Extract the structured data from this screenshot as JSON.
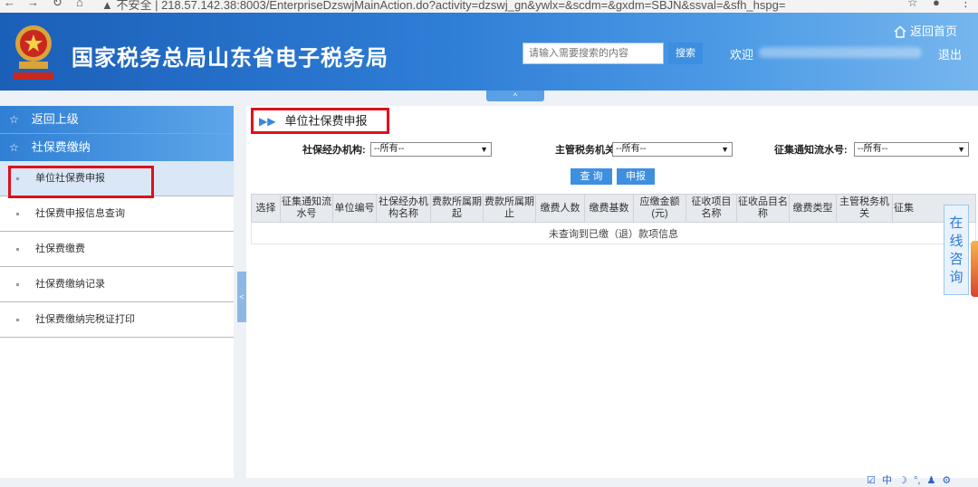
{
  "browser": {
    "url_text": "▲ 不安全 | 218.57.142.38:8003/EnterpriseDzswjMainAction.do?activity=dzswj_gn&ywlx=&scdm=&gxdm=SBJN&ssval=&sfh_hspg="
  },
  "header": {
    "site_title": "国家税务总局山东省电子税务局",
    "search_placeholder": "请输入需要搜索的内容",
    "search_button": "搜索",
    "welcome": "欢迎",
    "home_link": "返回首页",
    "logout": "退出",
    "collapse_arrow": "^"
  },
  "sidebar": {
    "back": "返回上级",
    "section": "社保费缴纳",
    "items": [
      {
        "label": "单位社保费申报"
      },
      {
        "label": "社保费申报信息查询"
      },
      {
        "label": "社保费缴费"
      },
      {
        "label": "社保费缴纳记录"
      },
      {
        "label": "社保费缴纳完税证打印"
      }
    ],
    "splitter_arrow": "<"
  },
  "main": {
    "page_title": "单位社保费申报",
    "filters": {
      "agency_label": "社保经办机构:",
      "agency_value": "--所有--",
      "tax_office_label": "主管税务机关:",
      "tax_office_value": "--所有--",
      "notice_label": "征集通知流水号:",
      "notice_value": "--所有--"
    },
    "buttons": {
      "query": "查 询",
      "declare": "申报"
    },
    "table": {
      "headers": [
        "选择",
        "征集通知流水号",
        "单位编号",
        "社保经办机构名称",
        "费款所属期起",
        "费款所属期止",
        "缴费人数",
        "缴费基数",
        "应缴金额(元)",
        "征收项目名称",
        "征收品目名称",
        "缴费类型",
        "主管税务机关",
        "征集"
      ],
      "empty_message": "未查询到已缴（退）款项信息"
    }
  },
  "consult_widget": {
    "text": "在线咨询"
  },
  "ime_bar": {
    "items": [
      "☑",
      "中",
      "☽",
      "°,",
      "♟",
      "⚙"
    ]
  }
}
